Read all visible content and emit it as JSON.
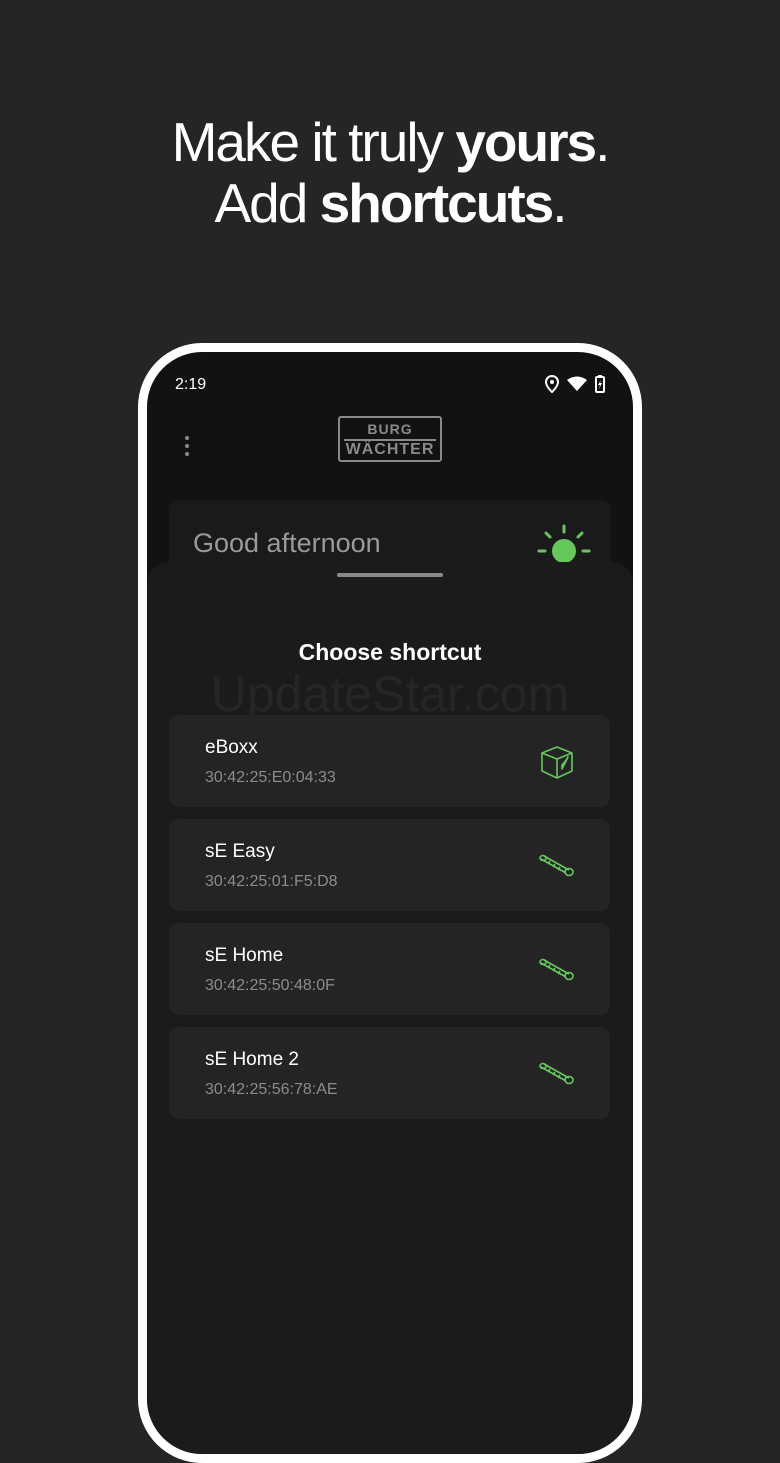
{
  "headline": {
    "line1_prefix": "Make it truly ",
    "line1_bold": "yours",
    "line1_suffix": ".",
    "line2_prefix": "Add ",
    "line2_bold": "shortcuts",
    "line2_suffix": "."
  },
  "status_bar": {
    "time": "2:19",
    "icons": [
      "location-icon",
      "wifi-icon",
      "battery-icon"
    ]
  },
  "app_header": {
    "logo_line1": "BURG",
    "logo_line2": "WÄCHTER",
    "menu_icon": "more-vert-icon"
  },
  "greeting": {
    "text": "Good afternoon",
    "icon": "sun-icon"
  },
  "sheet": {
    "title": "Choose shortcut",
    "watermark": "UpdateStar.com",
    "items": [
      {
        "name": "eBoxx",
        "mac": "30:42:25:E0:04:33",
        "icon": "box-icon"
      },
      {
        "name": "sE Easy",
        "mac": "30:42:25:01:F5:D8",
        "icon": "lock-cylinder-icon"
      },
      {
        "name": "sE Home",
        "mac": "30:42:25:50:48:0F",
        "icon": "lock-cylinder-icon"
      },
      {
        "name": "sE Home 2",
        "mac": "30:42:25:56:78:AE",
        "icon": "lock-cylinder-icon"
      }
    ]
  },
  "colors": {
    "background": "#252525",
    "phone_screen": "#121212",
    "sheet": "#1b1b1b",
    "card": "#242424",
    "accent_green": "#66c85a"
  }
}
